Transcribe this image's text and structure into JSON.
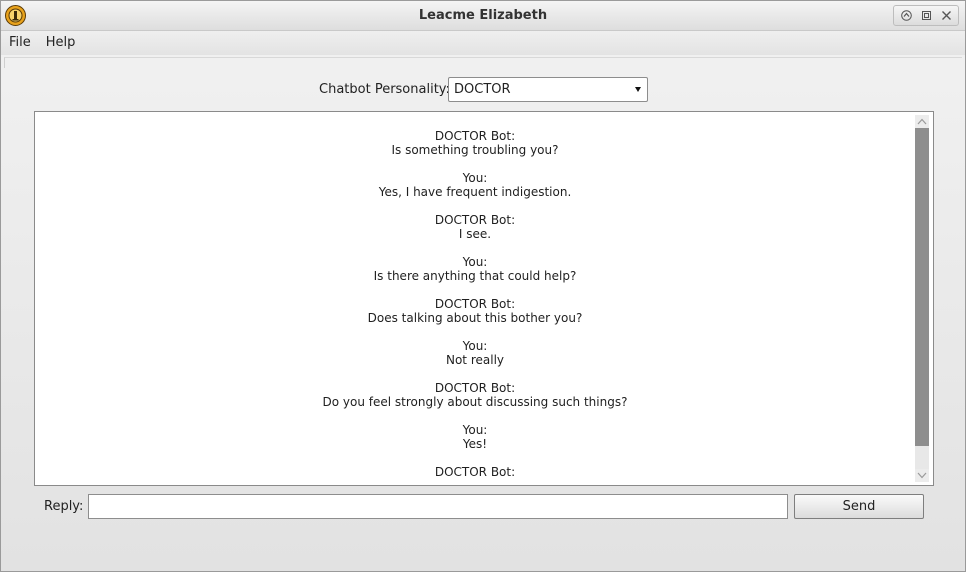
{
  "window": {
    "title": "Leacme Elizabeth",
    "app_icon": "elizabeth-app-icon",
    "controls": [
      "maximize-up-icon",
      "restore-icon",
      "close-icon"
    ]
  },
  "menu": {
    "file_label": "File",
    "help_label": "Help"
  },
  "personality": {
    "label": "Chatbot Personality:",
    "selected": "DOCTOR"
  },
  "chat": {
    "messages": [
      {
        "sender": "DOCTOR Bot:",
        "text": "Is something troubling you?"
      },
      {
        "sender": "You:",
        "text": "Yes, I have frequent indigestion."
      },
      {
        "sender": "DOCTOR Bot:",
        "text": "I see."
      },
      {
        "sender": "You:",
        "text": "Is there anything that could help?"
      },
      {
        "sender": "DOCTOR Bot:",
        "text": "Does talking about this bother you?"
      },
      {
        "sender": "You:",
        "text": "Not really"
      },
      {
        "sender": "DOCTOR Bot:",
        "text": "Do you feel strongly about discussing such things?"
      },
      {
        "sender": "You:",
        "text": "Yes!"
      },
      {
        "sender": "DOCTOR Bot:",
        "text": ""
      }
    ]
  },
  "reply": {
    "label": "Reply:",
    "value": "",
    "send_label": "Send"
  },
  "colors": {
    "window_bg": "#e4e4e4",
    "scroll_thumb": "#8e8e8e",
    "logo_orange": "#e8a21c"
  }
}
